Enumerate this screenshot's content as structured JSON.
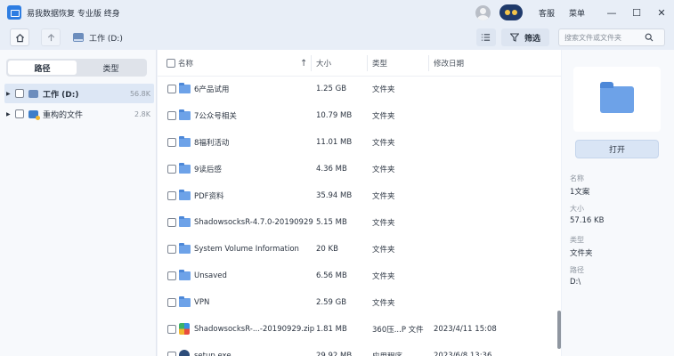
{
  "app": {
    "name": "易我数据恢复 专业版 终身",
    "service_label": "客服",
    "menu_label": "菜单",
    "minimize": "—",
    "maximize": "☐",
    "close": "✕"
  },
  "toolbar": {
    "breadcrumb": "工作 (D:)",
    "filter_label": "筛选",
    "search_placeholder": "搜索文件或文件夹"
  },
  "left_panel": {
    "tabs": [
      {
        "label": "路径",
        "active": true
      },
      {
        "label": "类型",
        "active": false
      }
    ],
    "tree": [
      {
        "label": "工作 (D:)",
        "size": "56.8K",
        "selected": true
      },
      {
        "label": "重构的文件",
        "size": "2.8K",
        "selected": false
      }
    ]
  },
  "file_list": {
    "columns": {
      "name": "名称",
      "size": "大小",
      "type": "类型",
      "date": "修改日期",
      "sort_indicator": "↑"
    },
    "rows": [
      {
        "name": "6产品试用",
        "size": "1.25 GB",
        "type": "文件夹",
        "date": "",
        "icon": "folder-icon"
      },
      {
        "name": "7公众号相关",
        "size": "10.79 MB",
        "type": "文件夹",
        "date": "",
        "icon": "folder-icon"
      },
      {
        "name": "8福利活动",
        "size": "11.01 MB",
        "type": "文件夹",
        "date": "",
        "icon": "folder-icon"
      },
      {
        "name": "9读后感",
        "size": "4.36 MB",
        "type": "文件夹",
        "date": "",
        "icon": "folder-icon"
      },
      {
        "name": "PDF资料",
        "size": "35.94 MB",
        "type": "文件夹",
        "date": "",
        "icon": "folder-icon"
      },
      {
        "name": "ShadowsocksR-4.7.0-20190929",
        "size": "5.15 MB",
        "type": "文件夹",
        "date": "",
        "icon": "folder-icon"
      },
      {
        "name": "System Volume Information",
        "size": "20 KB",
        "type": "文件夹",
        "date": "",
        "icon": "folder-icon"
      },
      {
        "name": "Unsaved",
        "size": "6.56 MB",
        "type": "文件夹",
        "date": "",
        "icon": "folder-icon"
      },
      {
        "name": "VPN",
        "size": "2.59 GB",
        "type": "文件夹",
        "date": "",
        "icon": "folder-icon"
      },
      {
        "name": "ShadowsocksR-...-20190929.zip",
        "size": "1.81 MB",
        "type": "360压...P 文件",
        "date": "2023/4/11 15:08",
        "icon": "zip-file-icon"
      },
      {
        "name": "setup.exe",
        "size": "29.92 MB",
        "type": "应用程序",
        "date": "2023/6/8 13:36",
        "icon": "exe-file-icon"
      }
    ]
  },
  "details": {
    "open_label": "打开",
    "fields": [
      {
        "label": "名称",
        "value": "1文案"
      },
      {
        "label": "大小",
        "value": "57.16 KB"
      },
      {
        "label": "类型",
        "value": "文件夹"
      },
      {
        "label": "路径",
        "value": "D:\\"
      }
    ]
  }
}
